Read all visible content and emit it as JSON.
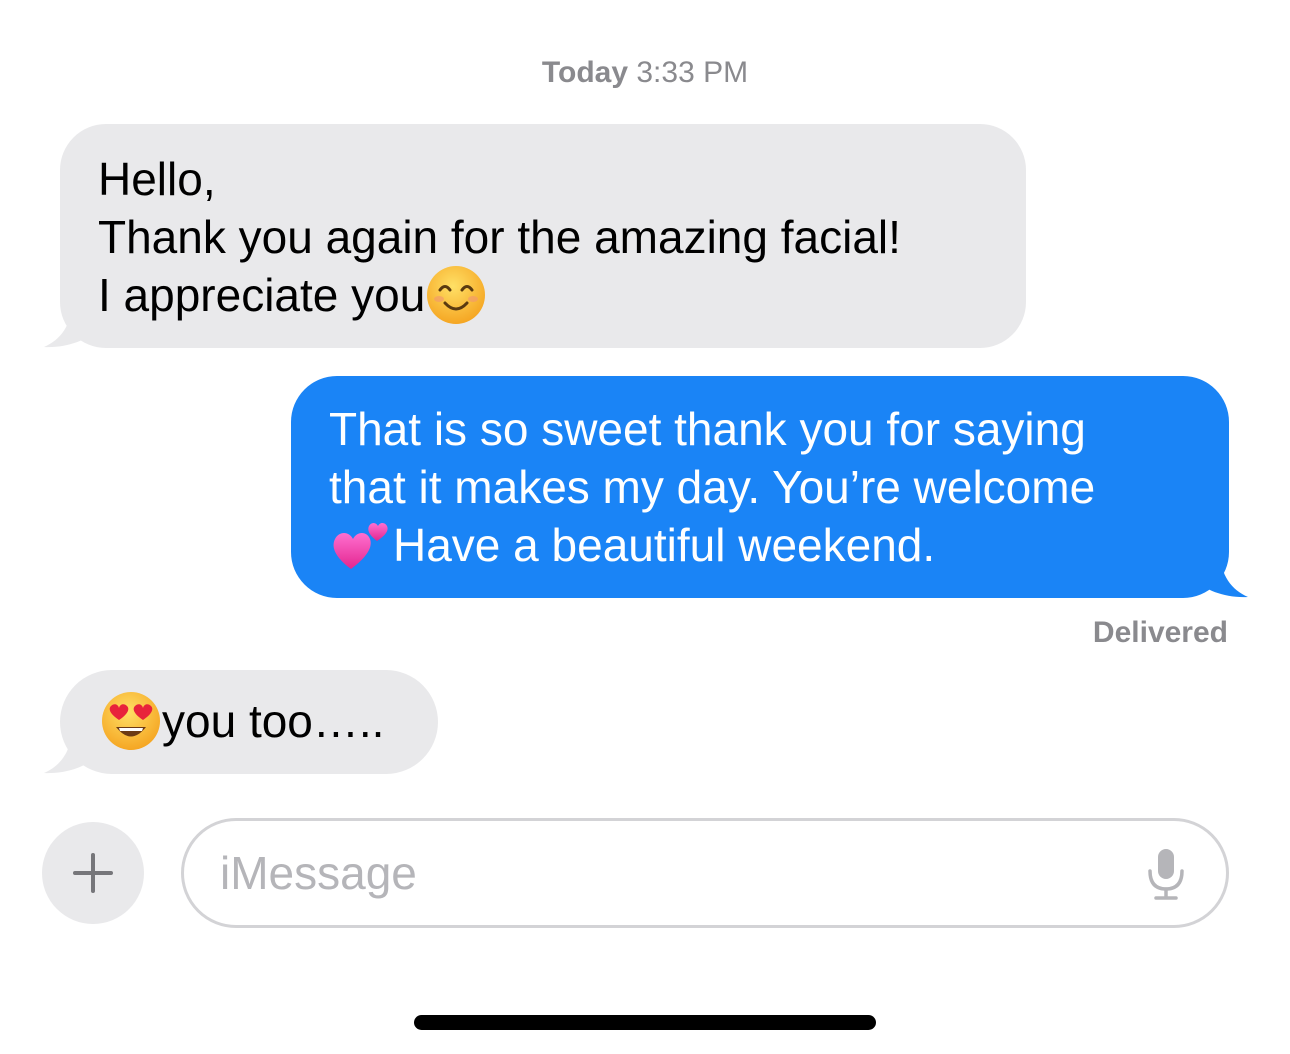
{
  "header": {
    "day": "Today",
    "time": "3:33 PM"
  },
  "messages": [
    {
      "direction": "incoming",
      "lines": [
        "Hello,",
        "Thank you again for the amazing facial!",
        "I appreciate you"
      ],
      "emoji": "smiling-face-with-smiling-eyes"
    },
    {
      "direction": "outgoing",
      "lines": [
        "That is so sweet thank you for saying",
        "that it makes my day. You’re welcome",
        "Have a beautiful weekend."
      ],
      "emoji": "two-hearts"
    },
    {
      "direction": "incoming",
      "lines": [
        "you too….."
      ],
      "emoji": "smiling-face-with-heart-eyes"
    }
  ],
  "status": {
    "delivered": "Delivered"
  },
  "composer": {
    "placeholder": "iMessage",
    "value": "",
    "plus_icon": "plus-icon",
    "mic_icon": "microphone-icon"
  },
  "colors": {
    "incoming_bubble": "#e9e9eb",
    "outgoing_bubble": "#1a84f6",
    "meta_text": "#8a8a8e",
    "placeholder_text": "#b5b5b9"
  }
}
